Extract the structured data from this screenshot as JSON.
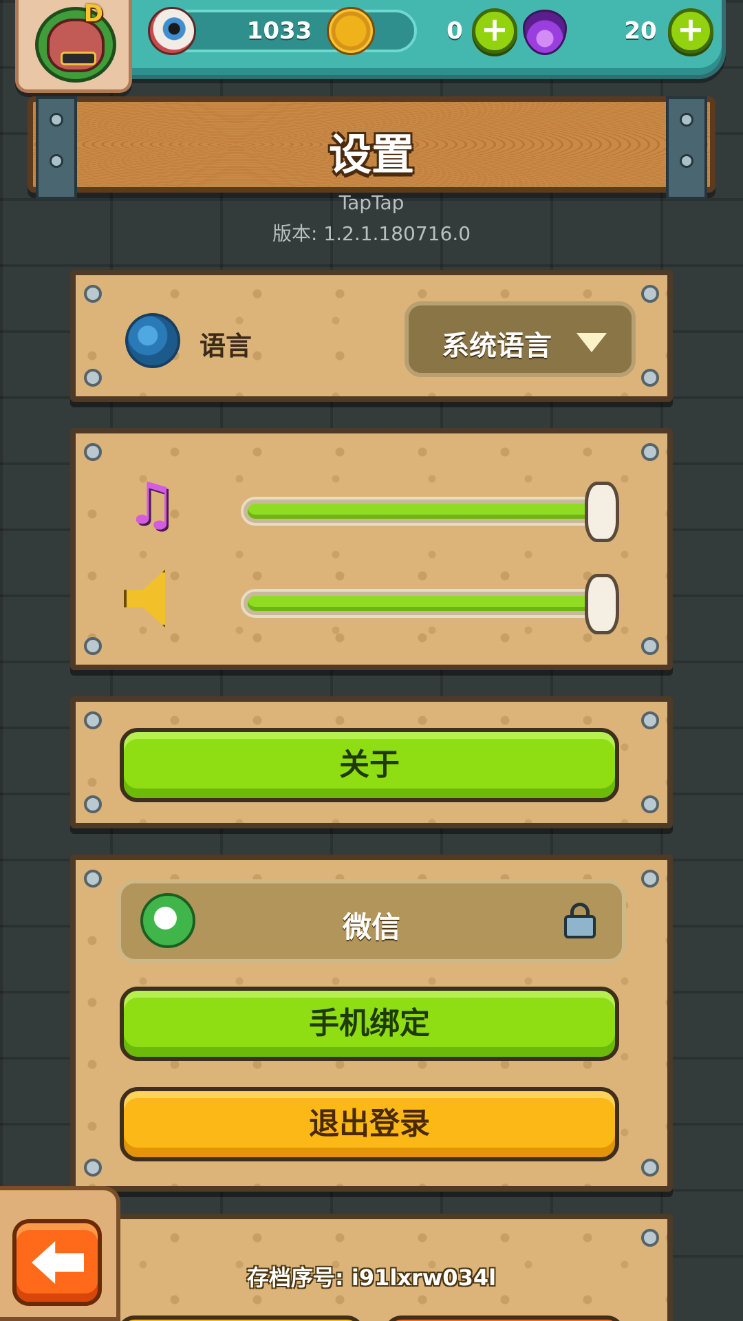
{
  "currencies": {
    "eyes": {
      "icon": "eyeball-icon",
      "value": "1033"
    },
    "coins": {
      "icon": "coin-icon",
      "value": "0"
    },
    "potions": {
      "icon": "potion-icon",
      "value": "20"
    }
  },
  "avatar": {
    "badge": "D"
  },
  "header": {
    "title": "设置"
  },
  "info": {
    "platform": "TapTap",
    "version": "版本: 1.2.1.180716.0"
  },
  "language": {
    "label": "语言",
    "selected": "系统语言"
  },
  "audio": {
    "music": {
      "icon": "music-note-icon",
      "level": 1.0
    },
    "sound": {
      "icon": "speaker-icon",
      "level": 1.0
    }
  },
  "buttons": {
    "about": "关于",
    "bind_phone": "手机绑定",
    "logout": "退出登录"
  },
  "account": {
    "wechat_label": "微信"
  },
  "save": {
    "id_text": "存档序号: i91lxrw034l"
  },
  "colors": {
    "green_button": "#8fde14",
    "yellow_button": "#fbb816",
    "back_button": "#ff6a1a"
  }
}
